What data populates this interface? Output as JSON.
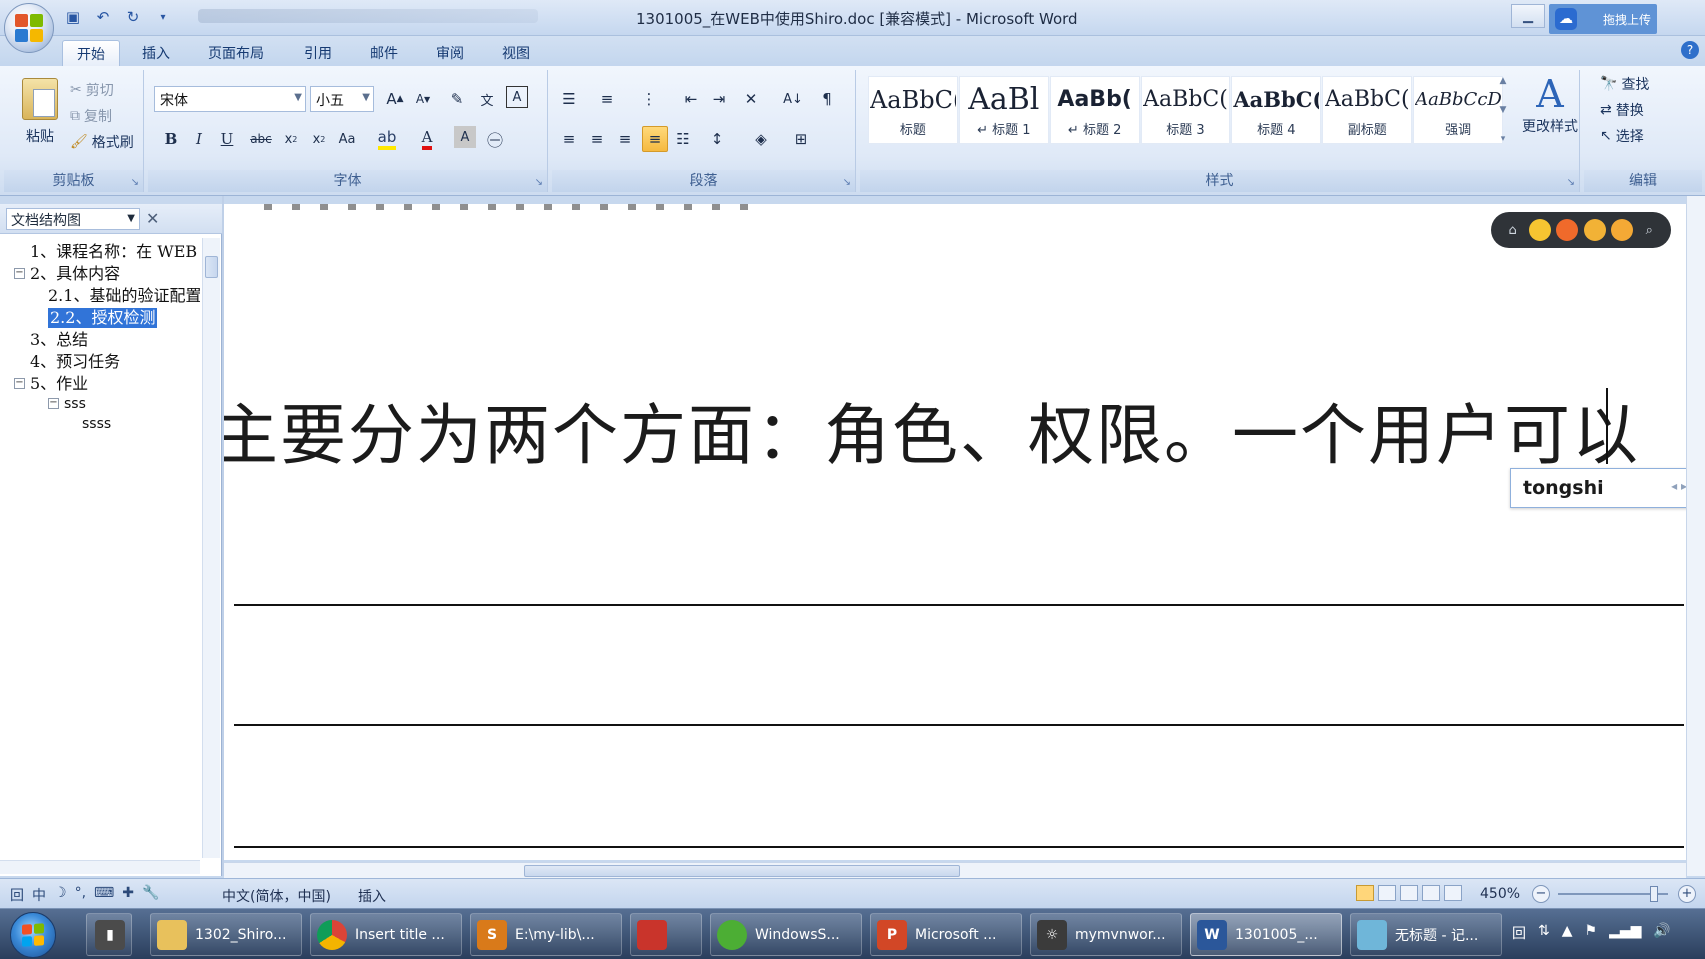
{
  "window": {
    "title": "1301005_在WEB中使用Shiro.doc [兼容模式] - Microsoft Word",
    "cloud_label": "拖拽上传"
  },
  "tabs": [
    {
      "label": "开始",
      "active": true
    },
    {
      "label": "插入"
    },
    {
      "label": "页面布局"
    },
    {
      "label": "引用"
    },
    {
      "label": "邮件"
    },
    {
      "label": "审阅"
    },
    {
      "label": "视图"
    }
  ],
  "ribbon": {
    "clipboard": {
      "label": "剪贴板",
      "paste": "粘贴",
      "cut": "剪切",
      "copy": "复制",
      "format_painter": "格式刷"
    },
    "font": {
      "label": "字体",
      "font_name": "宋体",
      "font_size": "小五"
    },
    "paragraph": {
      "label": "段落"
    },
    "styles": {
      "label": "样式",
      "items": [
        {
          "sample": "AaBbC(",
          "name": "标题"
        },
        {
          "sample": "AaBl",
          "name": "↵ 标题 1"
        },
        {
          "sample": "AaBb(",
          "name": "↵ 标题 2"
        },
        {
          "sample": "AaBbC(",
          "name": "标题 3"
        },
        {
          "sample": "AaBbC(",
          "name": "标题 4"
        },
        {
          "sample": "AaBbC(",
          "name": "副标题"
        },
        {
          "sample": "AaBbCcD(",
          "name": "强调"
        }
      ],
      "change_styles": "更改样式"
    },
    "editing": {
      "label": "编辑",
      "find": "查找",
      "replace": "替换",
      "select": "选择"
    }
  },
  "nav_pane": {
    "title": "文档结构图",
    "items": [
      {
        "text": "1、课程名称：在 WEB"
      },
      {
        "text": "2、具体内容"
      },
      {
        "text": "2.1、基础的验证配置"
      },
      {
        "text": "2.2、授权检测",
        "selected": true
      },
      {
        "text": "3、总结"
      },
      {
        "text": "4、预习任务"
      },
      {
        "text": "5、作业"
      },
      {
        "text": "sss"
      },
      {
        "text": "ssss"
      }
    ]
  },
  "document": {
    "body_text": "主要分为两个方面：角色、权限。一个用户可以",
    "ime_composition": "tongshi"
  },
  "statusbar": {
    "language": "中文(简体，中国)",
    "mode": "插入",
    "zoom": "450%"
  },
  "taskbar": {
    "items": [
      {
        "label": "1302_Shiro..."
      },
      {
        "label": "Insert title ..."
      },
      {
        "label": "E:\\my-lib\\..."
      },
      {
        "label": ""
      },
      {
        "label": "WindowsS..."
      },
      {
        "label": "Microsoft ..."
      },
      {
        "label": "mymvnwor..."
      },
      {
        "label": "1301005_..."
      },
      {
        "label": "无标题 - 记..."
      }
    ]
  }
}
